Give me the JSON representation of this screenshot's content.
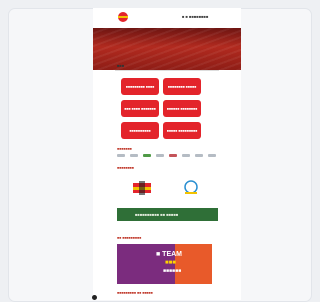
{
  "header": {
    "logo_icon": "federation-logo-icon",
    "right_text": "■ ■ ■■■■■■■■"
  },
  "breadcrumb": "■■■",
  "tiles": [
    "■■■■■■■■■ ■■■■",
    "■■■■■■■■ ■■■■■",
    "■■■ ■■■■ ■■■■■■■",
    "■■■■■■ ■■■■■■■■",
    "■■■■■■■■■■",
    "■■■■■ ■■■■■■■■■"
  ],
  "sections": {
    "sponsors": "■■■■■■■",
    "partners": "■■■■■■■■",
    "promo": "■■ ■■■■■■■■■",
    "bottom": "■■■■■■■■■ ■■ ■■■■■"
  },
  "banner": {
    "text": "■■■■■■■■■■ ■■ ■■■■■"
  },
  "promo": {
    "line1": "■ TEAM",
    "line2": "■■■",
    "line3": "■■■■■■"
  },
  "colors": {
    "accent": "#e3242b",
    "hero": "#b22a1f",
    "banner": "#2f6f37",
    "promo_bg": "#7b2c7e",
    "promo_accent": "#e85a2a"
  }
}
